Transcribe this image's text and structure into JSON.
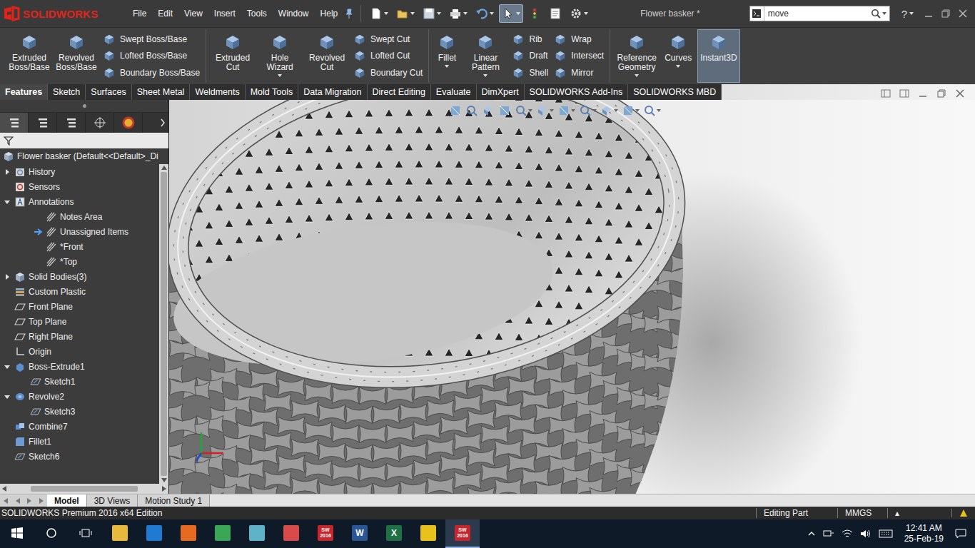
{
  "app": {
    "logo": "SOLIDWORKS",
    "title": "Flower basker *"
  },
  "menu": [
    {
      "label": "File"
    },
    {
      "label": "Edit"
    },
    {
      "label": "View"
    },
    {
      "label": "Insert"
    },
    {
      "label": "Tools"
    },
    {
      "label": "Window"
    },
    {
      "label": "Help"
    }
  ],
  "quick_access": [
    {
      "kind": "new",
      "dropdown": true,
      "selected": false
    },
    {
      "kind": "open",
      "dropdown": true,
      "selected": false
    },
    {
      "kind": "save",
      "dropdown": true,
      "selected": false
    },
    {
      "kind": "print",
      "dropdown": true,
      "selected": false
    },
    {
      "kind": "undo",
      "dropdown": true,
      "selected": false
    },
    {
      "kind": "select",
      "dropdown": true,
      "selected": true
    },
    {
      "kind": "rebuild",
      "dropdown": false,
      "selected": false
    },
    {
      "kind": "file-properties",
      "dropdown": false,
      "selected": false
    },
    {
      "kind": "options",
      "dropdown": true,
      "selected": false
    }
  ],
  "search": {
    "value": "move"
  },
  "help": "?",
  "ribbon": [
    {
      "items": [
        {
          "kind": "large",
          "label": "Extruded Boss/Base",
          "dropdown": false,
          "selected": false
        },
        {
          "kind": "large",
          "label": "Revolved Boss/Base",
          "dropdown": false,
          "selected": false
        },
        {
          "kind": "column",
          "buttons": [
            {
              "label": "Swept Boss/Base"
            },
            {
              "label": "Lofted Boss/Base"
            },
            {
              "label": "Boundary Boss/Base"
            }
          ]
        }
      ]
    },
    {
      "items": [
        {
          "kind": "large",
          "label": "Extruded Cut",
          "dropdown": false,
          "selected": false
        },
        {
          "kind": "large",
          "label": "Hole Wizard",
          "dropdown": true,
          "selected": false
        },
        {
          "kind": "large",
          "label": "Revolved Cut",
          "dropdown": false,
          "selected": false
        },
        {
          "kind": "column",
          "buttons": [
            {
              "label": "Swept Cut"
            },
            {
              "label": "Lofted Cut"
            },
            {
              "label": "Boundary Cut"
            }
          ]
        }
      ]
    },
    {
      "items": [
        {
          "kind": "large",
          "label": "Fillet",
          "dropdown": true,
          "selected": false
        },
        {
          "kind": "large",
          "label": "Linear Pattern",
          "dropdown": true,
          "selected": false
        },
        {
          "kind": "column",
          "buttons": [
            {
              "label": "Rib"
            },
            {
              "label": "Draft"
            },
            {
              "label": "Shell"
            }
          ]
        },
        {
          "kind": "column",
          "buttons": [
            {
              "label": "Wrap"
            },
            {
              "label": "Intersect"
            },
            {
              "label": "Mirror"
            }
          ]
        }
      ]
    },
    {
      "items": [
        {
          "kind": "large",
          "label": "Reference Geometry",
          "dropdown": true,
          "selected": false
        },
        {
          "kind": "large",
          "label": "Curves",
          "dropdown": true,
          "selected": false
        },
        {
          "kind": "large",
          "label": "Instant3D",
          "dropdown": false,
          "selected": true
        }
      ]
    }
  ],
  "tabs": [
    {
      "label": "Features",
      "selected": true
    },
    {
      "label": "Sketch",
      "selected": false
    },
    {
      "label": "Surfaces",
      "selected": false
    },
    {
      "label": "Sheet Metal",
      "selected": false
    },
    {
      "label": "Weldments",
      "selected": false
    },
    {
      "label": "Mold Tools",
      "selected": false
    },
    {
      "label": "Data Migration",
      "selected": false
    },
    {
      "label": "Direct Editing",
      "selected": false
    },
    {
      "label": "Evaluate",
      "selected": false
    },
    {
      "label": "DimXpert",
      "selected": false
    },
    {
      "label": "SOLIDWORKS Add-Ins",
      "selected": false
    },
    {
      "label": "SOLIDWORKS MBD",
      "selected": false
    }
  ],
  "feature_tree": {
    "root": {
      "label": "Flower basker  (Default<<Default>_Di",
      "kind": "part"
    },
    "items": [
      {
        "label": "History",
        "kind": "history",
        "depth": 0,
        "expandable": true,
        "expanded": false,
        "marker": false
      },
      {
        "label": "Sensors",
        "kind": "sensors",
        "depth": 0,
        "expandable": false,
        "expanded": false,
        "marker": false
      },
      {
        "label": "Annotations",
        "kind": "annotations",
        "depth": 0,
        "expandable": true,
        "expanded": true,
        "marker": false
      },
      {
        "label": "Notes Area",
        "kind": "notes",
        "depth": 2,
        "expandable": false,
        "expanded": false,
        "marker": false
      },
      {
        "label": "Unassigned Items",
        "kind": "notes",
        "depth": 2,
        "expandable": false,
        "expanded": false,
        "marker": true
      },
      {
        "label": "*Front",
        "kind": "view",
        "depth": 2,
        "expandable": false,
        "expanded": false,
        "marker": false
      },
      {
        "label": "*Top",
        "kind": "view",
        "depth": 2,
        "expandable": false,
        "expanded": false,
        "marker": false
      },
      {
        "label": "Solid Bodies(3)",
        "kind": "solids",
        "depth": 0,
        "expandable": true,
        "expanded": false,
        "marker": false
      },
      {
        "label": "Custom Plastic",
        "kind": "material",
        "depth": 0,
        "expandable": false,
        "expanded": false,
        "marker": false
      },
      {
        "label": "Front Plane",
        "kind": "plane",
        "depth": 0,
        "expandable": false,
        "expanded": false,
        "marker": false
      },
      {
        "label": "Top Plane",
        "kind": "plane",
        "depth": 0,
        "expandable": false,
        "expanded": false,
        "marker": false
      },
      {
        "label": "Right Plane",
        "kind": "plane",
        "depth": 0,
        "expandable": false,
        "expanded": false,
        "marker": false
      },
      {
        "label": "Origin",
        "kind": "origin",
        "depth": 0,
        "expandable": false,
        "expanded": false,
        "marker": false
      },
      {
        "label": "Boss-Extrude1",
        "kind": "extrude",
        "depth": 0,
        "expandable": true,
        "expanded": true,
        "marker": false
      },
      {
        "label": "Sketch1",
        "kind": "sketch",
        "depth": 1,
        "expandable": false,
        "expanded": false,
        "marker": false
      },
      {
        "label": "Revolve2",
        "kind": "revolve",
        "depth": 0,
        "expandable": true,
        "expanded": true,
        "marker": false
      },
      {
        "label": "Sketch3",
        "kind": "sketch",
        "depth": 1,
        "expandable": false,
        "expanded": false,
        "marker": false
      },
      {
        "label": "Combine7",
        "kind": "combine",
        "depth": 0,
        "expandable": false,
        "expanded": false,
        "marker": false
      },
      {
        "label": "Fillet1",
        "kind": "fillet",
        "depth": 0,
        "expandable": false,
        "expanded": false,
        "marker": false
      },
      {
        "label": "Sketch6",
        "kind": "sketch",
        "depth": 0,
        "expandable": false,
        "expanded": false,
        "marker": false
      }
    ]
  },
  "bottom_tabs": [
    {
      "label": "Model",
      "selected": true
    },
    {
      "label": "3D Views",
      "selected": false
    },
    {
      "label": "Motion Study 1",
      "selected": false
    }
  ],
  "status_bar": {
    "edition": "SOLIDWORKS Premium 2016 x64 Edition",
    "mode": "Editing Part",
    "units": "MMGS",
    "arrow": "▴"
  },
  "taskbar": {
    "apps": [
      {
        "kind": "file-explorer",
        "glyph": "",
        "active": false
      },
      {
        "kind": "edge",
        "glyph": "",
        "active": false
      },
      {
        "kind": "firefox",
        "glyph": "",
        "active": false
      },
      {
        "kind": "chrome",
        "glyph": "",
        "active": false
      },
      {
        "kind": "app",
        "glyph": "",
        "active": false
      },
      {
        "kind": "draft",
        "glyph": "",
        "active": false
      },
      {
        "kind": "solidworks",
        "glyph": "SW 2016",
        "active": false
      },
      {
        "kind": "word",
        "glyph": "W",
        "active": false
      },
      {
        "kind": "excel",
        "glyph": "X",
        "active": false
      },
      {
        "kind": "player",
        "glyph": "",
        "active": false
      },
      {
        "kind": "solidworks",
        "glyph": "SW 2016",
        "active": true
      }
    ],
    "time": "12:41 AM",
    "date": "25-Feb-19"
  }
}
